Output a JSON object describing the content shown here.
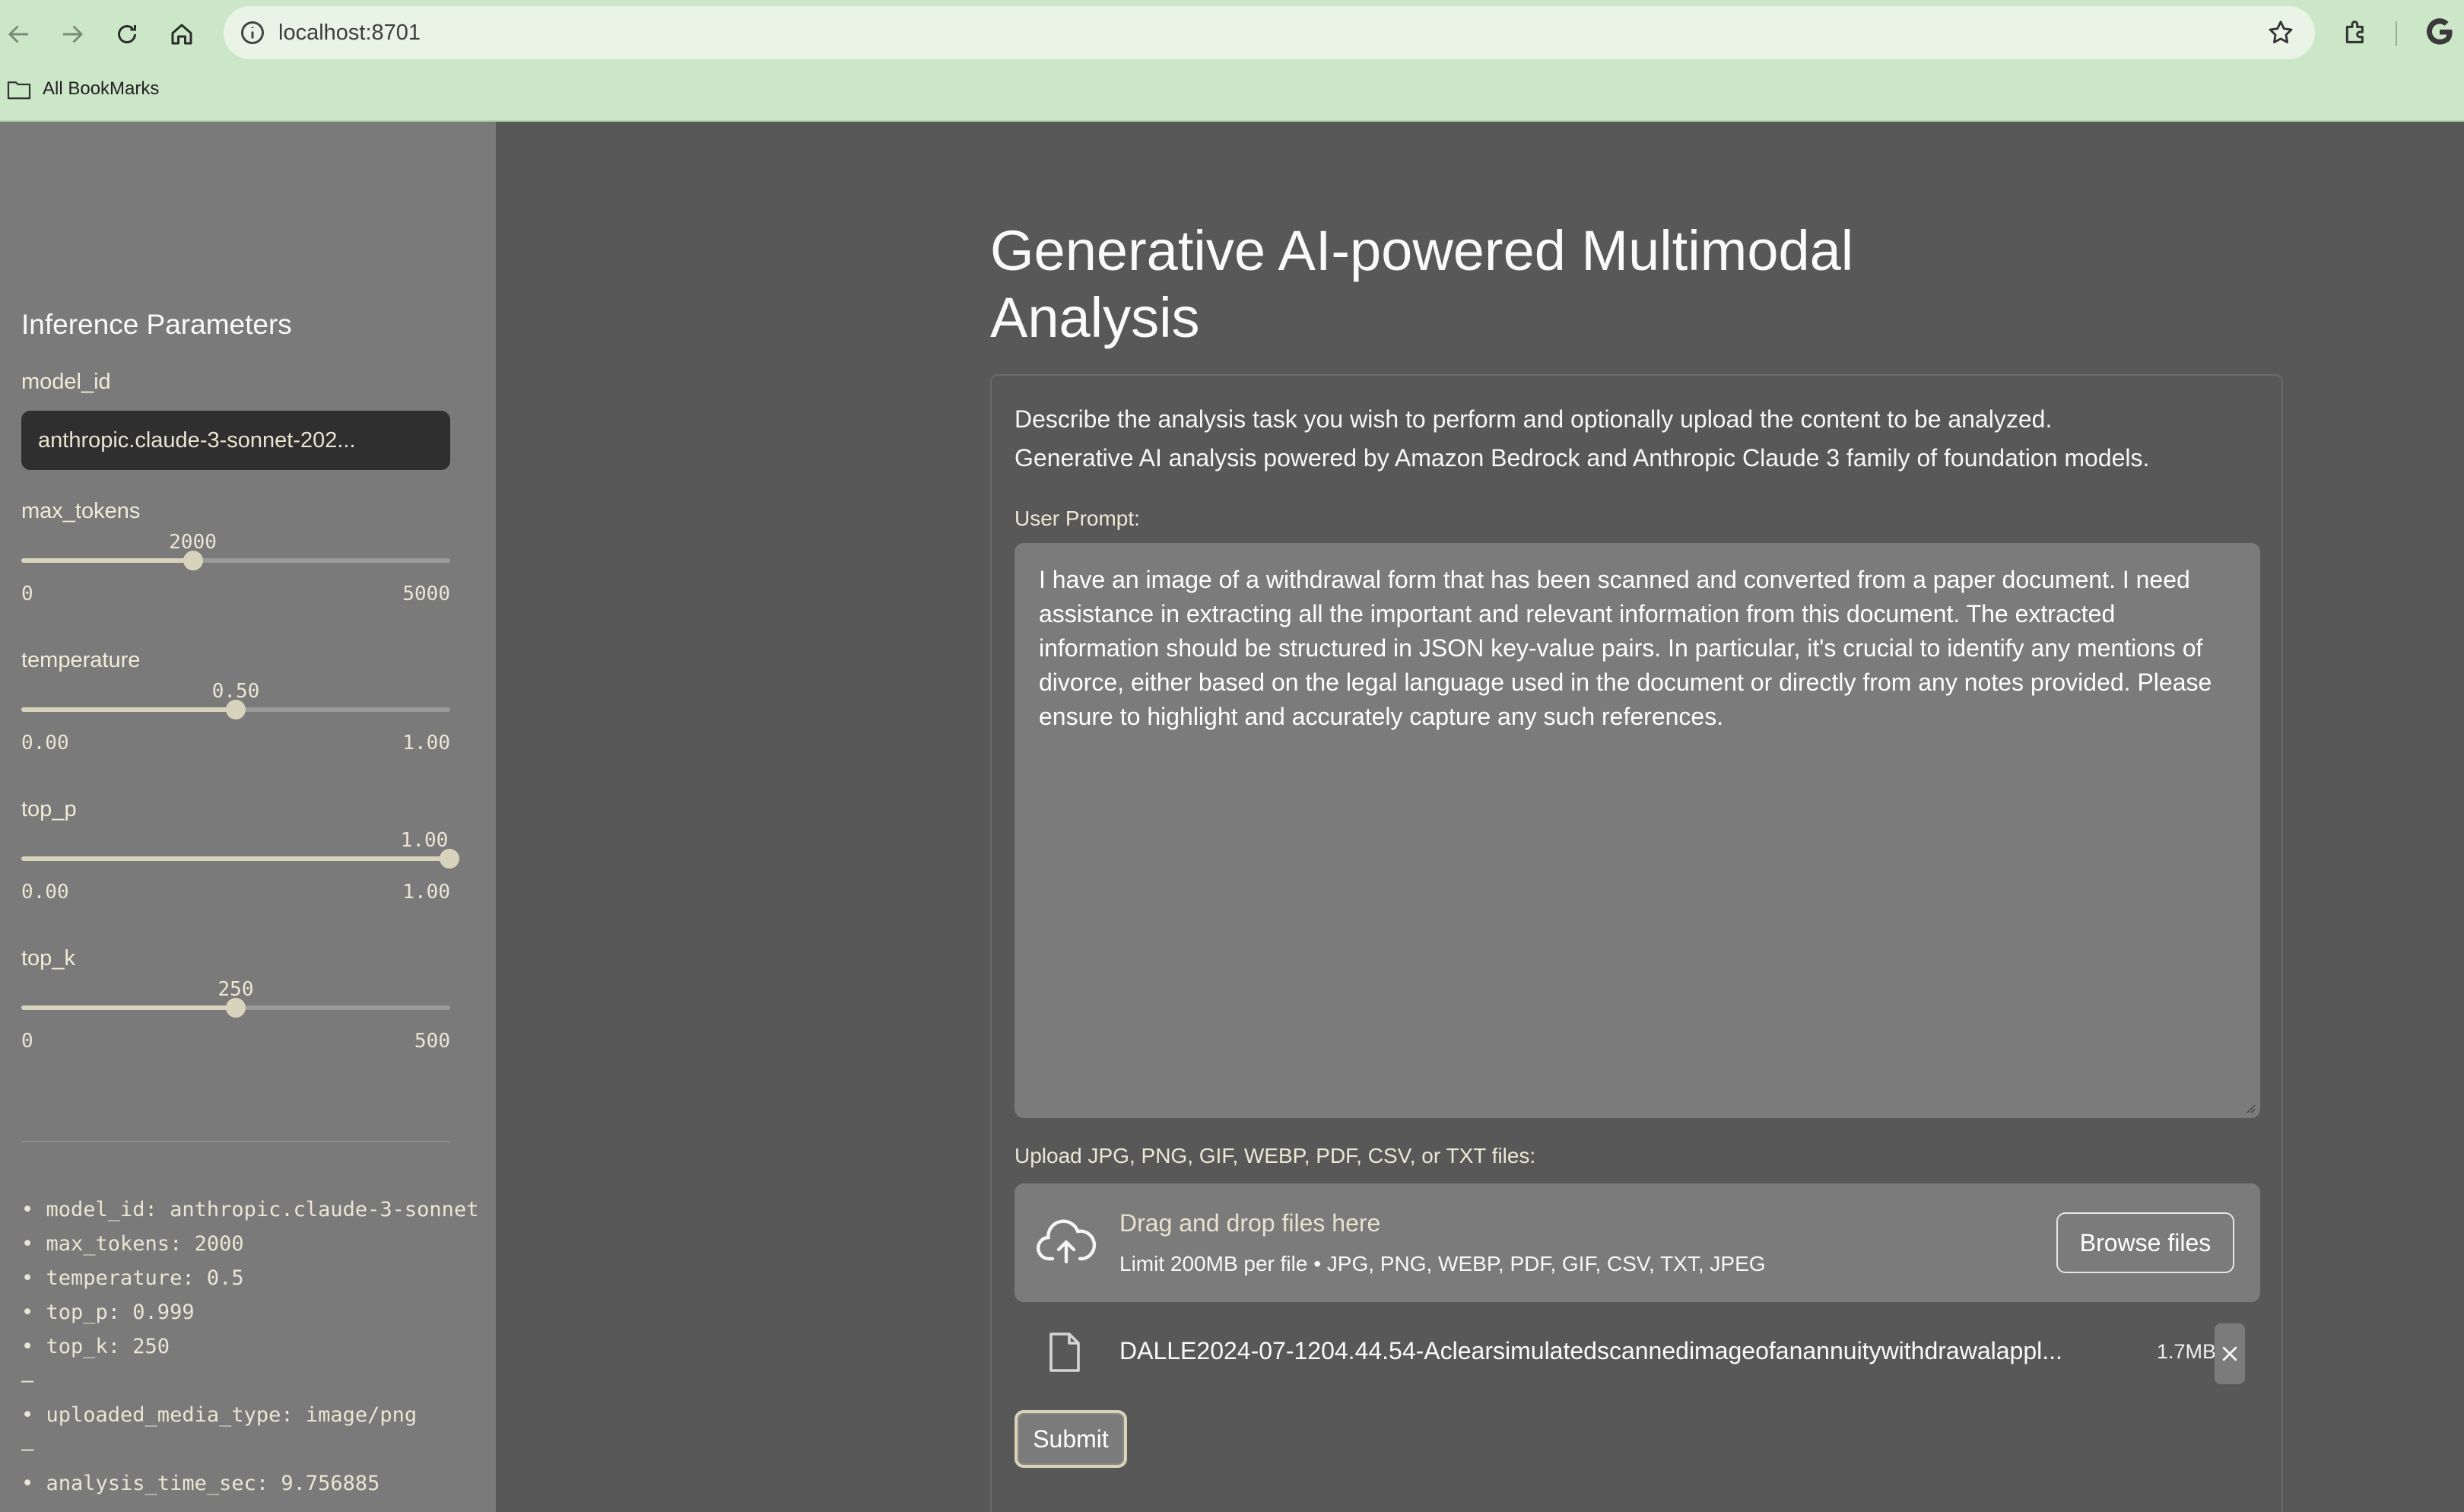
{
  "browser": {
    "url": "localhost:8701",
    "bookmarks_label": "All BookMarks"
  },
  "sidebar": {
    "title": "Inference Parameters",
    "model_id": {
      "label": "model_id",
      "value": "anthropic.claude-3-sonnet-202..."
    },
    "sliders": [
      {
        "key": "max_tokens",
        "label": "max_tokens",
        "value_label": "2000",
        "value": 2000,
        "min_label": "0",
        "max_label": "5000",
        "min": 0,
        "max": 5000
      },
      {
        "key": "temperature",
        "label": "temperature",
        "value_label": "0.50",
        "value": 0.5,
        "min_label": "0.00",
        "max_label": "1.00",
        "min": 0,
        "max": 1
      },
      {
        "key": "top_p",
        "label": "top_p",
        "value_label": "1.00",
        "value": 1.0,
        "min_label": "0.00",
        "max_label": "1.00",
        "min": 0,
        "max": 1
      },
      {
        "key": "top_k",
        "label": "top_k",
        "value_label": "250",
        "value": 250,
        "min_label": "0",
        "max_label": "500",
        "min": 0,
        "max": 500
      }
    ],
    "summary": {
      "params": [
        "• model_id: anthropic.claude-3-sonnet",
        "• max_tokens: 2000",
        "• temperature: 0.5",
        "• top_p: 0.999",
        "• top_k: 250"
      ],
      "separator": "—",
      "media": "• uploaded_media_type: image/png",
      "timing": "• analysis_time_sec: 9.756885"
    }
  },
  "main": {
    "title": "Generative AI-powered Multimodal Analysis",
    "description_line1": "Describe the analysis task you wish to perform and optionally upload the content to be analyzed.",
    "description_line2": "Generative AI analysis powered by Amazon Bedrock and Anthropic Claude 3 family of foundation models.",
    "prompt_label": "User Prompt:",
    "prompt_text": "I have an image of a withdrawal form that has been scanned and converted from a paper document. I need assistance in extracting all the important and relevant information from this document. The extracted information should be structured in JSON key-value pairs. In particular, it's crucial to identify any mentions of divorce, either based on the legal language used in the document or directly from any notes provided. Please ensure to highlight and accurately capture any such references.",
    "upload_label": "Upload JPG, PNG, GIF, WEBP, PDF, CSV, or TXT files:",
    "dropzone_title": "Drag and drop files here",
    "dropzone_sub": "Limit 200MB per file • JPG, PNG, WEBP, PDF, GIF, CSV, TXT, JPEG",
    "browse_label": "Browse files",
    "file_name": "DALLE2024-07-1204.44.54-Aclearsimulatedscannedimageofanannuitywithdrawalappl...",
    "file_size": "1.7MB",
    "submit_label": "Submit"
  },
  "colors": {
    "chrome_bg": "#cce7c8",
    "sidebar_bg": "#7a7a7a",
    "main_bg": "#585858",
    "accent": "#d8d3bd"
  }
}
